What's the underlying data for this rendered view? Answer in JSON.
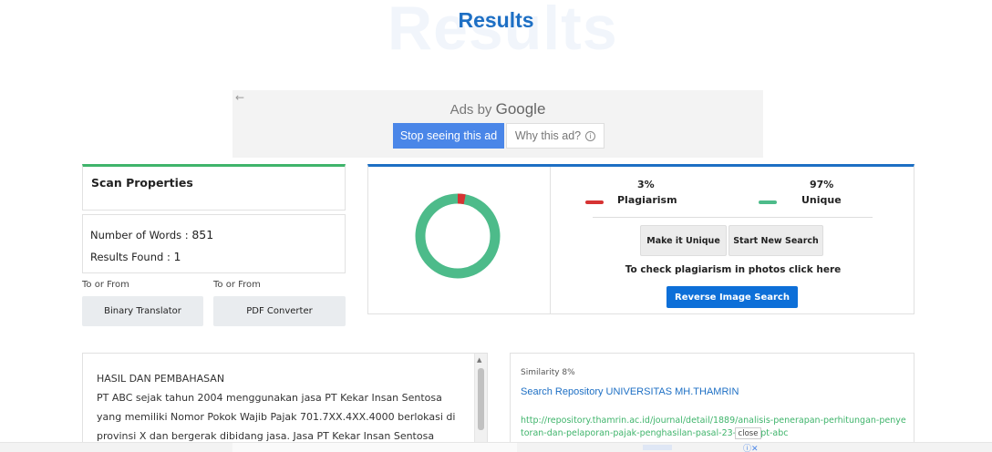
{
  "header": {
    "title": "Results",
    "watermark": "Results"
  },
  "ad": {
    "back_arrow": "←",
    "ads_by": "Ads by",
    "google": "Google",
    "stop_label": "Stop seeing this ad",
    "why_label": "Why this ad?",
    "info_glyph": "i"
  },
  "scan": {
    "title": "Scan Properties",
    "words_label": "Number of Words : ",
    "words_value": "851",
    "results_label": "Results Found : ",
    "results_value": "1"
  },
  "tools": [
    {
      "caption": "To or From",
      "label": "Binary Translator"
    },
    {
      "caption": "To or From",
      "label": "PDF Converter"
    }
  ],
  "result": {
    "plagiarism_pct": "3%",
    "unique_pct": "97%",
    "plagiarism_label": "Plagiarism",
    "unique_label": "Unique",
    "plagiarism_value": 3,
    "unique_value": 97,
    "plagiarism_color": "#d63333",
    "unique_color": "#4dbb8a",
    "make_unique_label": "Make it Unique",
    "new_search_label": "Start New Search",
    "photo_text": "To check plagiarism in photos click here",
    "reverse_search_label": "Reverse Image Search"
  },
  "text_panel": {
    "lines": [
      "HASIL DAN PEMBAHASAN",
      "PT ABC sejak tahun 2004 menggunakan jasa PT Kekar Insan Sentosa",
      "yang memiliki Nomor Pokok Wajib Pajak 701.7XX.4XX.4000  berlokasi di",
      "provinsi X dan bergerak dibidang jasa. Jasa PT Kekar Insan Sentosa"
    ]
  },
  "match": {
    "similarity": "Similarity 8%",
    "source": "Search Repository UNIVERSITAS MH.THAMRIN",
    "url": "http://repository.thamrin.ac.id/journal/detail/1889/analisis-penerapan-perhitungan-penyetoran-dan-pelaporan-pajak-penghasilan-pasal-23-pada-pt-abc"
  },
  "close_label": "close",
  "colors": {
    "brand": "#1d6fc4",
    "accent_green": "#3fb46b",
    "button_blue": "#0d6fd8"
  }
}
